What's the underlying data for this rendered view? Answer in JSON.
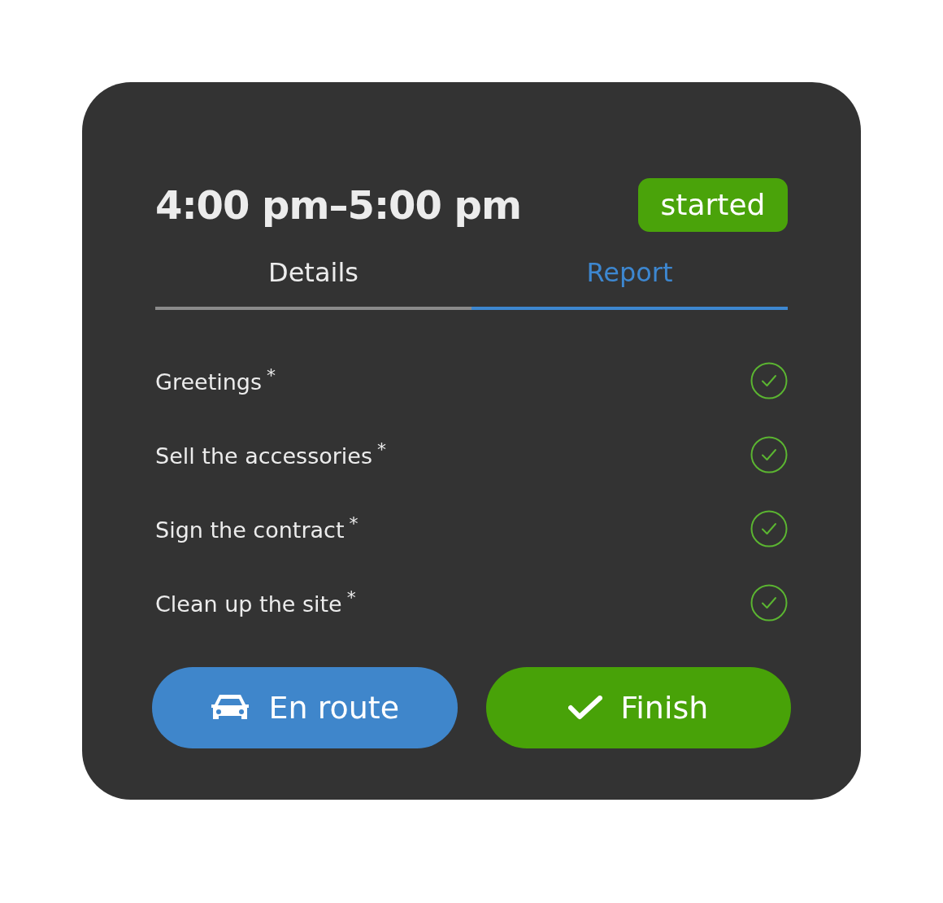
{
  "card": {
    "time_range": "4:00 pm–5:00 pm",
    "status": "started",
    "tabs": [
      {
        "label": "Details",
        "selected": false
      },
      {
        "label": "Report",
        "selected": true
      }
    ],
    "tasks": [
      {
        "label": "Greetings",
        "required_mark": "*",
        "checked": true
      },
      {
        "label": "Sell the accessories",
        "required_mark": "*",
        "checked": true
      },
      {
        "label": "Sign the contract",
        "required_mark": "*",
        "checked": true
      },
      {
        "label": "Clean up the site",
        "required_mark": "*",
        "checked": true
      }
    ],
    "buttons": [
      {
        "label": "En route",
        "kind": "car"
      },
      {
        "label": "Finish",
        "kind": "check"
      }
    ]
  }
}
